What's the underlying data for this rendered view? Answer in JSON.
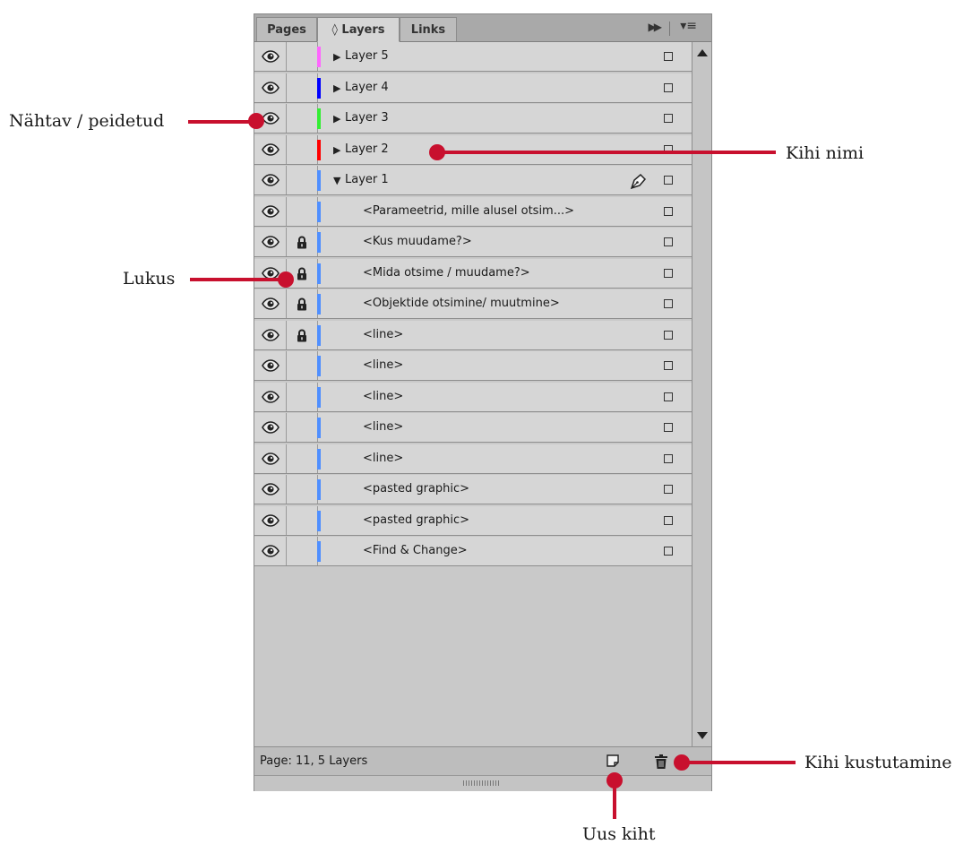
{
  "tabs": [
    {
      "label": "Pages",
      "active": false
    },
    {
      "label": "◊ Layers",
      "active": true
    },
    {
      "label": "Links",
      "active": false
    }
  ],
  "tab_controls": {
    "collapse_icon": "double-arrow-right-icon",
    "menu_icon": "panel-menu-icon"
  },
  "rows": [
    {
      "label": "Layer 5",
      "kind": "layer",
      "twisty": "collapsed",
      "color": "#ff66ff",
      "locked": false
    },
    {
      "label": "Layer 4",
      "kind": "layer",
      "twisty": "collapsed",
      "color": "#0000ff",
      "locked": false
    },
    {
      "label": "Layer 3",
      "kind": "layer",
      "twisty": "collapsed",
      "color": "#33ee33",
      "locked": false
    },
    {
      "label": "Layer 2",
      "kind": "layer",
      "twisty": "collapsed",
      "color": "#ff0000",
      "locked": false
    },
    {
      "label": "Layer 1",
      "kind": "layer",
      "twisty": "expanded",
      "color": "#4f8fff",
      "locked": false,
      "pen": true
    },
    {
      "label": "<Parameetrid, mille alusel otsim...>",
      "kind": "item",
      "color": "#4f8fff",
      "locked": false
    },
    {
      "label": "<Kus muudame?>",
      "kind": "item",
      "color": "#4f8fff",
      "locked": true
    },
    {
      "label": "<Mida otsime / muudame?>",
      "kind": "item",
      "color": "#4f8fff",
      "locked": true
    },
    {
      "label": "<Objektide otsimine/ muutmine>",
      "kind": "item",
      "color": "#4f8fff",
      "locked": true
    },
    {
      "label": "<line>",
      "kind": "item",
      "color": "#4f8fff",
      "locked": true
    },
    {
      "label": "<line>",
      "kind": "item",
      "color": "#4f8fff",
      "locked": false
    },
    {
      "label": "<line>",
      "kind": "item",
      "color": "#4f8fff",
      "locked": false
    },
    {
      "label": "<line>",
      "kind": "item",
      "color": "#4f8fff",
      "locked": false
    },
    {
      "label": "<line>",
      "kind": "item",
      "color": "#4f8fff",
      "locked": false
    },
    {
      "label": "<pasted graphic>",
      "kind": "item",
      "color": "#4f8fff",
      "locked": false
    },
    {
      "label": "<pasted graphic>",
      "kind": "item",
      "color": "#4f8fff",
      "locked": false
    },
    {
      "label": "<Find & Change>",
      "kind": "item",
      "color": "#4f8fff",
      "locked": false
    }
  ],
  "footer": {
    "status": "Page: 11, 5 Layers"
  },
  "callouts": {
    "visible": "Nähtav / peidetud",
    "lock": "Lukus",
    "name": "Kihi nimi",
    "delete": "Kihi kustutamine",
    "new": "Uus kiht"
  },
  "callout_color": "#c8102e"
}
